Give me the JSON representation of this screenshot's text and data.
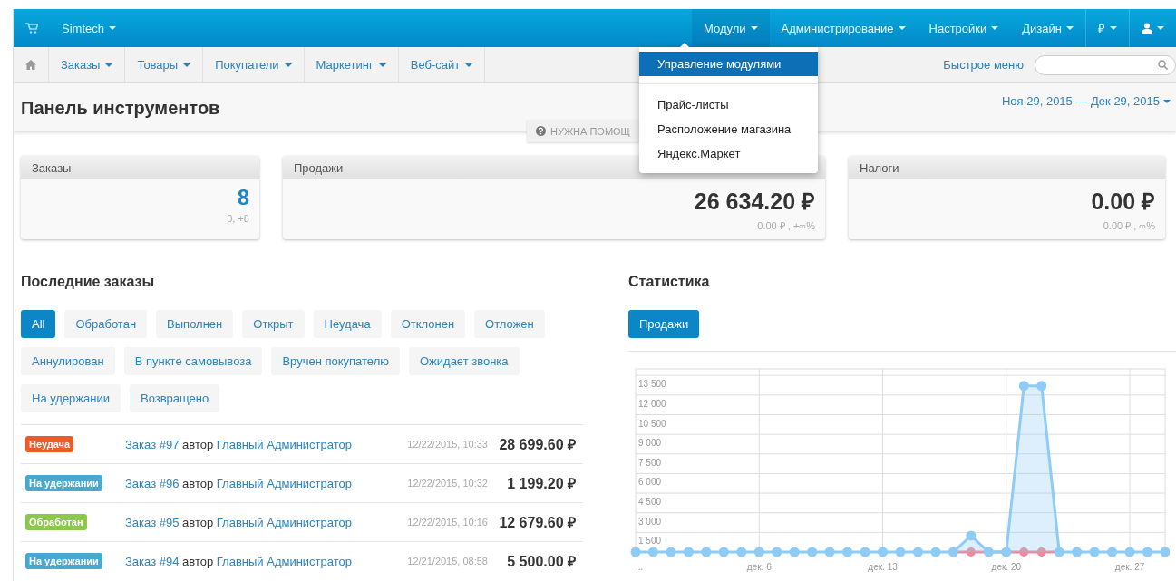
{
  "topbar": {
    "brand": "Simtech",
    "menus": [
      {
        "label": "Модули",
        "selected": true
      },
      {
        "label": "Администрирование",
        "selected": false
      },
      {
        "label": "Настройки",
        "selected": false
      },
      {
        "label": "Дизайн",
        "selected": false
      },
      {
        "label": "₽",
        "selected": false,
        "kind": "currency"
      },
      {
        "selected": false,
        "kind": "user"
      }
    ]
  },
  "modules_menu": {
    "items": [
      {
        "label": "Управление модулями",
        "selected": true
      },
      {
        "label": "Прайс-листы",
        "selected": false
      },
      {
        "label": "Расположение магазина",
        "selected": false
      },
      {
        "label": "Яндекс.Маркет",
        "selected": false
      }
    ]
  },
  "navbar": {
    "items": [
      "Заказы",
      "Товары",
      "Покупатели",
      "Маркетинг",
      "Веб-сайт"
    ],
    "quick_menu": "Быстрое меню"
  },
  "page": {
    "title": "Панель инструментов",
    "help": "НУЖНА ПОМОЩ",
    "date_range": "Ноя 29, 2015 — Дек 29, 2015"
  },
  "cards": [
    {
      "title": "Заказы",
      "value": "8",
      "sub": "0, +8",
      "kind": "count"
    },
    {
      "title": "Продажи",
      "value": "26 634.20 ₽",
      "sub": "0.00 ₽ , +∞%",
      "kind": "money"
    },
    {
      "title": "Налоги",
      "value": "0.00 ₽",
      "sub": "0.00 ₽ , ∞%",
      "kind": "money"
    }
  ],
  "recent_orders": {
    "title": "Последние заказы",
    "filters": [
      {
        "label": "All",
        "selected": true
      },
      {
        "label": "Обработан",
        "selected": false
      },
      {
        "label": "Выполнен",
        "selected": false
      },
      {
        "label": "Открыт",
        "selected": false
      },
      {
        "label": "Неудача",
        "selected": false
      },
      {
        "label": "Отклонен",
        "selected": false
      },
      {
        "label": "Отложен",
        "selected": false
      },
      {
        "label": "Аннулирован",
        "selected": false
      },
      {
        "label": "В пункте самовывоза",
        "selected": false
      },
      {
        "label": "Вручен покупателю",
        "selected": false
      },
      {
        "label": "Ожидает звонка",
        "selected": false
      },
      {
        "label": "На удержании",
        "selected": false
      },
      {
        "label": "Возвращено",
        "selected": false
      }
    ],
    "orders": [
      {
        "status": "Неудача",
        "color": "#f05a28",
        "order": "Заказ #97",
        "by": "автор",
        "author": "Главный Администратор",
        "date": "12/22/2015, 10:33",
        "total": "28 699.60 ₽"
      },
      {
        "status": "На удержании",
        "color": "#4aa8d0",
        "order": "Заказ #96",
        "by": "автор",
        "author": "Главный Администратор",
        "date": "12/22/2015, 10:32",
        "total": "1 199.20 ₽"
      },
      {
        "status": "Обработан",
        "color": "#8cc94a",
        "order": "Заказ #95",
        "by": "автор",
        "author": "Главный Администратор",
        "date": "12/22/2015, 10:16",
        "total": "12 679.60 ₽"
      },
      {
        "status": "На удержании",
        "color": "#4aa8d0",
        "order": "Заказ #94",
        "by": "автор",
        "author": "Главный Администратор",
        "date": "12/21/2015, 08:58",
        "total": "5 500.00 ₽"
      }
    ]
  },
  "statistics": {
    "title": "Статистика",
    "tabs": [
      {
        "label": "Продажи",
        "selected": true
      }
    ],
    "chart_data": {
      "type": "line",
      "categories": [
        "...",
        null,
        null,
        null,
        null,
        null,
        null,
        "дек. 6",
        null,
        null,
        null,
        null,
        null,
        null,
        "дек. 13",
        null,
        null,
        null,
        null,
        null,
        null,
        "дек. 20",
        null,
        null,
        null,
        null,
        null,
        null,
        "дек. 27",
        null,
        null
      ],
      "series": [
        {
          "color": "#8ecbf5",
          "marker": "circle",
          "values": [
            0,
            0,
            0,
            0,
            0,
            0,
            0,
            0,
            0,
            0,
            0,
            0,
            0,
            0,
            0,
            0,
            0,
            0,
            0,
            1250,
            0,
            0,
            12700,
            12700,
            0,
            0,
            0,
            0,
            0,
            0,
            0
          ]
        },
        {
          "color": "#f08a9a",
          "values": [
            null,
            null,
            null,
            null,
            null,
            null,
            null,
            null,
            null,
            null,
            null,
            null,
            null,
            null,
            null,
            null,
            null,
            null,
            0,
            0,
            0,
            0,
            0,
            0,
            0,
            null,
            null,
            null,
            null,
            null,
            null
          ]
        }
      ],
      "ylim": [
        0,
        14000
      ],
      "grid": true,
      "yticks": [
        {
          "value": 1500,
          "label": "1 500"
        },
        {
          "value": 3000,
          "label": "3 000"
        },
        {
          "value": 4500,
          "label": "4 500"
        },
        {
          "value": 6000,
          "label": "6 000"
        },
        {
          "value": 7500,
          "label": "7 500"
        },
        {
          "value": 9000,
          "label": "9 000"
        },
        {
          "value": 10500,
          "label": "10 500"
        },
        {
          "value": 12000,
          "label": "12 000"
        },
        {
          "value": 13500,
          "label": "13 500"
        }
      ]
    }
  }
}
